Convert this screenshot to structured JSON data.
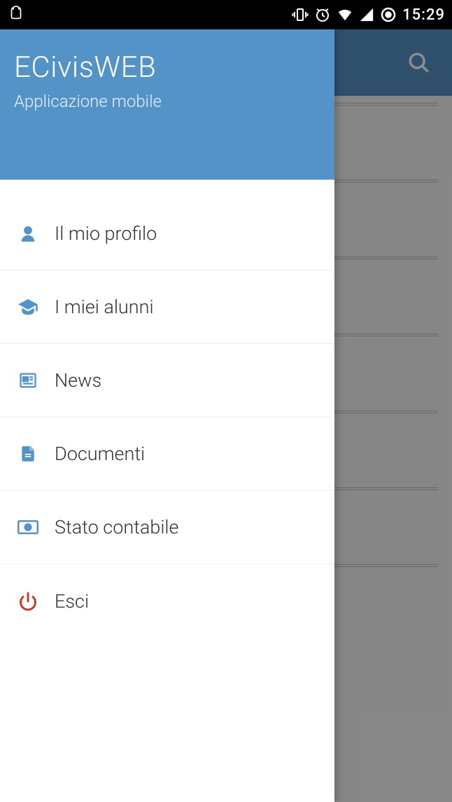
{
  "status": {
    "time": "15:29"
  },
  "drawer": {
    "title": "ECivisWEB",
    "subtitle": "Applicazione mobile",
    "items": [
      {
        "label": "Il mio profilo",
        "icon": "user"
      },
      {
        "label": "I miei alunni",
        "icon": "graduation"
      },
      {
        "label": "News",
        "icon": "newspaper"
      },
      {
        "label": "Documenti",
        "icon": "document"
      },
      {
        "label": "Stato contabile",
        "icon": "money"
      },
      {
        "label": "Esci",
        "icon": "power"
      }
    ]
  }
}
